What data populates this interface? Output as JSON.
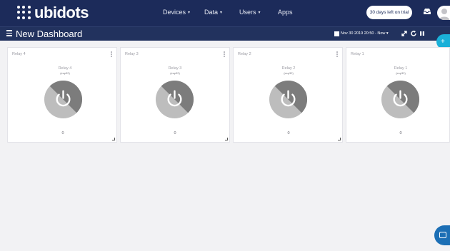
{
  "brand": {
    "name": "ubidots"
  },
  "nav": [
    {
      "label": "Devices",
      "caret": "▾"
    },
    {
      "label": "Data",
      "caret": "▾"
    },
    {
      "label": "Users",
      "caret": "▾"
    },
    {
      "label": "Apps",
      "caret": ""
    }
  ],
  "header": {
    "trial_label": "30 days left on trial",
    "inbox_icon": "inbox-icon",
    "avatar_icon": "user-avatar"
  },
  "dashboard": {
    "menu_icon": "hamburger-icon",
    "title": "New Dashboard",
    "date_range": "Nov 30 2019 20:50 - Now",
    "date_caret": "▾",
    "tools": [
      "expand-icon",
      "refresh-icon",
      "pause-icon"
    ],
    "add_label": "+"
  },
  "widgets": [
    {
      "card_label": "Relay 4",
      "name": "Relay 4",
      "device": "(esp32)",
      "value": "0"
    },
    {
      "card_label": "Relay 3",
      "name": "Relay 3",
      "device": "(esp32)",
      "value": "0"
    },
    {
      "card_label": "Relay 2",
      "name": "Relay 2",
      "device": "(esp32)",
      "value": "0"
    },
    {
      "card_label": "Relay 1",
      "name": "Relay 1",
      "device": "(esp32)",
      "value": "0"
    }
  ],
  "colors": {
    "topbar": "#1c2b5a",
    "subbar": "#22325e",
    "accent": "#1ab0d8",
    "switch_light": "#bdbdbd",
    "switch_dark": "#7c7c7c",
    "chat": "#1c6fb5"
  }
}
